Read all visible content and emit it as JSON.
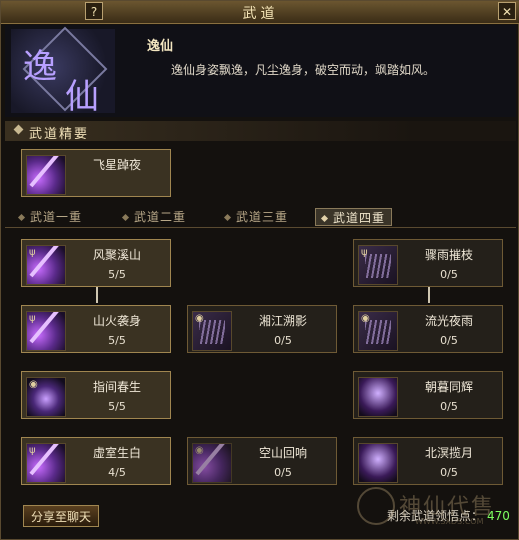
{
  "window": {
    "title": "武道",
    "help_label": "?",
    "close_label": "✕"
  },
  "header": {
    "emblem_chars": [
      "逸",
      "仙"
    ],
    "name": "逸仙",
    "description": "逸仙身姿飘逸，凡尘逸身，破空而动，飒踏如风。"
  },
  "essence": {
    "section_label": "武道精要",
    "skill": {
      "name": "飞星踔夜",
      "icon": "shooting-star-icon"
    }
  },
  "tabs": [
    {
      "label": "武道一重",
      "selected": false
    },
    {
      "label": "武道二重",
      "selected": false
    },
    {
      "label": "武道三重",
      "selected": false
    },
    {
      "label": "武道四重",
      "selected": true
    }
  ],
  "skills": [
    {
      "name": "风聚溪山",
      "level": "5/5",
      "icon": "purple",
      "active": true
    },
    {
      "name": "骤雨摧枝",
      "level": "0/5",
      "icon": "dim",
      "active": false
    },
    {
      "name": "山火袭身",
      "level": "5/5",
      "icon": "purple",
      "active": true
    },
    {
      "name": "湘江溯影",
      "level": "0/5",
      "icon": "dim",
      "active": false
    },
    {
      "name": "流光夜雨",
      "level": "0/5",
      "icon": "dim",
      "active": false
    },
    {
      "name": "指间春生",
      "level": "5/5",
      "icon": "orb",
      "active": true
    },
    {
      "name": "朝暮同辉",
      "level": "0/5",
      "icon": "figure",
      "active": false
    },
    {
      "name": "虚室生白",
      "level": "4/5",
      "icon": "purple",
      "active": true
    },
    {
      "name": "空山回响",
      "level": "0/5",
      "icon": "purple",
      "active": false
    },
    {
      "name": "北溟揽月",
      "level": "0/5",
      "icon": "figure",
      "active": false
    }
  ],
  "footer": {
    "share_label": "分享至聊天",
    "points_label": "剩余武道领悟点：",
    "points_value": "470"
  },
  "watermark": {
    "text": "神仙代售",
    "url": "WWW.SXDS.COM"
  },
  "colors": {
    "points": "#7cff60",
    "accent_border": "#a08650"
  }
}
